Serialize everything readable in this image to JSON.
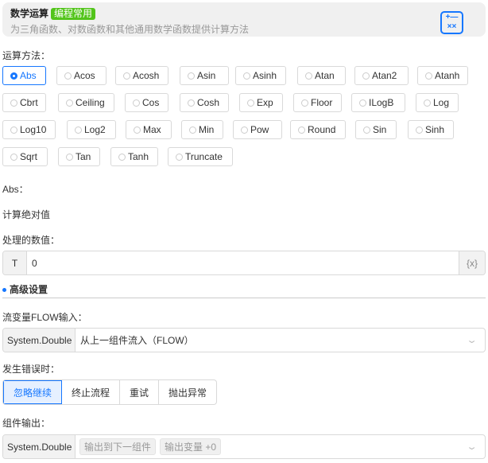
{
  "header": {
    "title": "数学运算",
    "badge": "编程常用",
    "description": "为三角函数、对数函数和其他通用数学函数提供计算方法",
    "icon": "calculator-icon"
  },
  "method_label": "运算方法：",
  "methods": [
    "Abs",
    "Acos",
    "Acosh",
    "Asin",
    "Asinh",
    "Atan",
    "Atan2",
    "Atanh",
    "Cbrt",
    "Ceiling",
    "Cos",
    "Cosh",
    "Exp",
    "Floor",
    "ILogB",
    "Log",
    "Log10",
    "Log2",
    "Max",
    "Min",
    "Pow",
    "Round",
    "Sin",
    "Sinh",
    "Sqrt",
    "Tan",
    "Tanh",
    "Truncate"
  ],
  "selected_method": "Abs",
  "method_title": "Abs：",
  "method_desc": "计算绝对值",
  "value_label": "处理的数值：",
  "value_prefix": "T",
  "value": "0",
  "value_suffix": "{x}",
  "advanced": "高级设置",
  "flow_label": "流变量FLOW输入：",
  "flow_type": "System.Double",
  "flow_value": "从上一组件流入（FLOW）",
  "error_label": "发生错误时：",
  "error_options": [
    "忽略继续",
    "终止流程",
    "重试",
    "抛出异常"
  ],
  "output_label": "组件输出：",
  "output_type": "System.Double",
  "output_tags": [
    "输出到下一组件",
    "输出变量 +0"
  ]
}
